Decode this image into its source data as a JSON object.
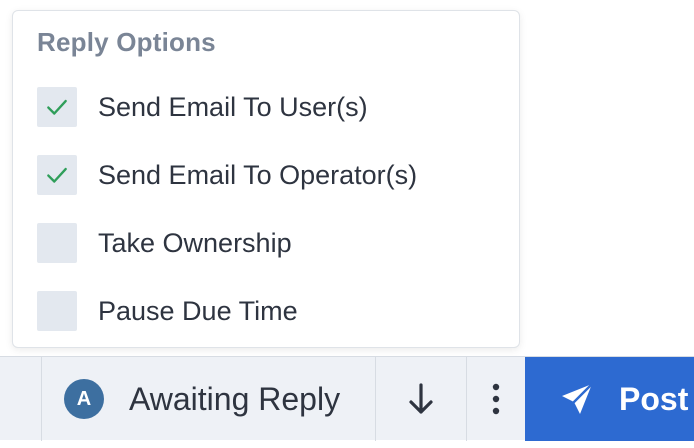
{
  "reply_options": {
    "title": "Reply Options",
    "items": [
      {
        "label": "Send Email To User(s)",
        "checked": true
      },
      {
        "label": "Send Email To Operator(s)",
        "checked": true
      },
      {
        "label": "Take Ownership",
        "checked": false
      },
      {
        "label": "Pause Due Time",
        "checked": false
      }
    ]
  },
  "toolbar": {
    "status_avatar": "A",
    "status_label": "Awaiting Reply",
    "sort_icon": "arrow-down-icon",
    "more_icon": "more-vertical-icon",
    "post_icon": "send-icon",
    "post_label": "Post"
  },
  "colors": {
    "accent": "#2d6ad1",
    "check": "#2f9e5a",
    "avatar": "#3d6fa0",
    "checkbox_bg": "#e3e8ef",
    "bar_bg": "#eef1f6"
  }
}
